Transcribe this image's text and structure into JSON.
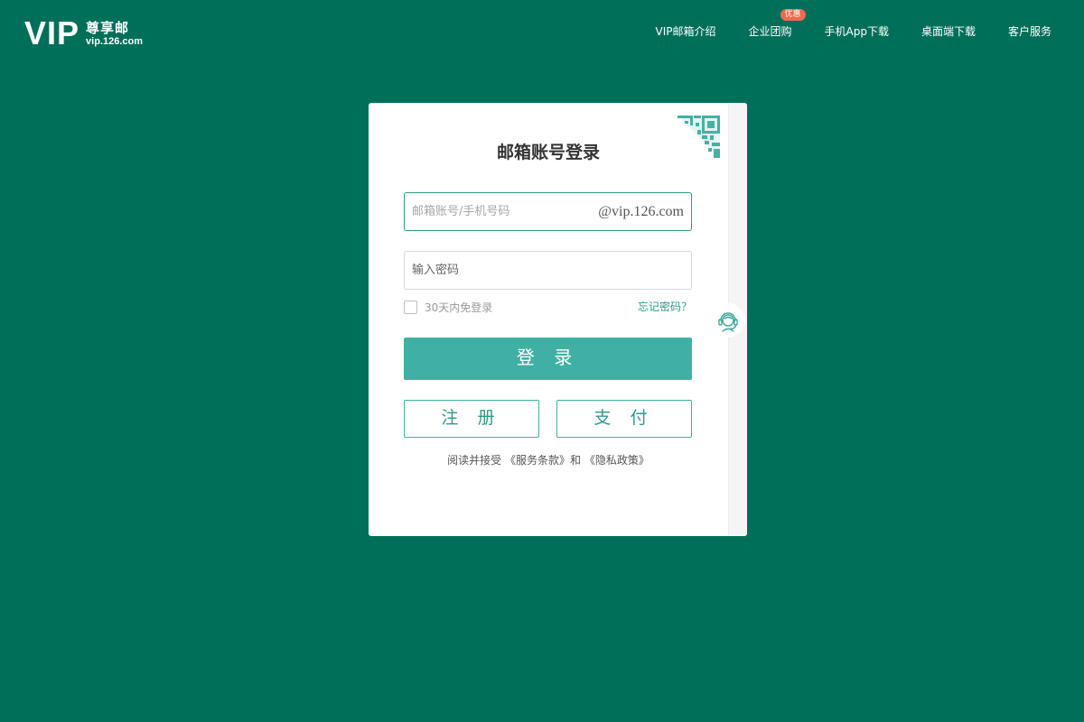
{
  "logo": {
    "brand": "VIP",
    "name": "尊享邮",
    "domain": "vip.126.com"
  },
  "nav": [
    {
      "label": "VIP邮箱介绍"
    },
    {
      "label": "企业团购",
      "badge": "优惠"
    },
    {
      "label": "手机App下载"
    },
    {
      "label": "桌面端下载"
    },
    {
      "label": "客户服务"
    }
  ],
  "login": {
    "title": "邮箱账号登录",
    "account_placeholder": "邮箱账号/手机号码",
    "account_suffix": "@vip.126.com",
    "password_placeholder": "输入密码",
    "remember_label": "30天内免登录",
    "forgot_label": "忘记密码？",
    "login_button": "登 录",
    "register_button": "注 册",
    "pay_button": "支 付",
    "terms_prefix": "阅读并接受 ",
    "terms_service": "《服务条款》",
    "terms_and": "和 ",
    "terms_privacy": "《隐私政策》"
  },
  "icons": {
    "qr": "qr-code-icon",
    "support": "customer-service-icon",
    "checkbox": "checkbox-unchecked"
  },
  "colors": {
    "background": "#006f59",
    "accent": "#40b0a4",
    "accent_text": "#2d9a8a",
    "badge": "#ef6a4e"
  }
}
